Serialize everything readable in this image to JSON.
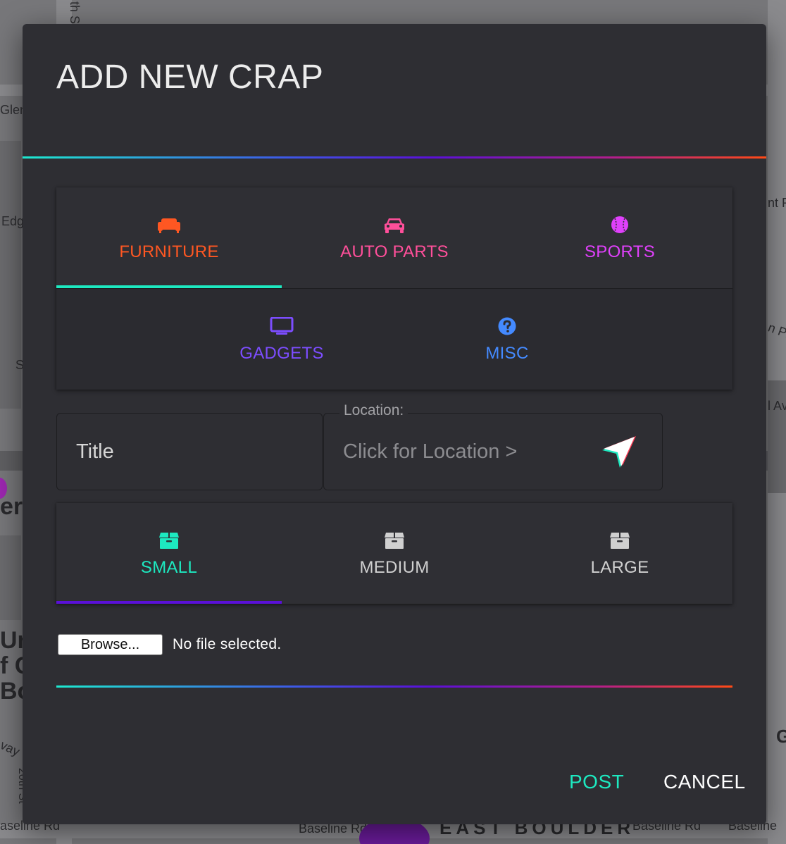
{
  "colors": {
    "accent_teal": "#1de9c0",
    "furniture": "#ff5722",
    "auto_parts": "#ff4f9a",
    "sports": "#e040fb",
    "gadgets": "#7c4dff",
    "misc": "#448aff",
    "inactive": "#d0d0d0",
    "size_indicator": "#5a10d8"
  },
  "map": {
    "labels": [
      "th St",
      "Glen",
      "Edg",
      "nt R",
      "n Pk",
      "S",
      "l Av",
      "er",
      "Un",
      "f C",
      "Bo",
      "vay",
      "20th St",
      "aseline Rd",
      "Baseline Rd",
      "EAST BOULDER",
      "Baseline Rd",
      "Baseline",
      "G"
    ]
  },
  "dialog": {
    "title": "ADD NEW CRAP"
  },
  "categories": {
    "tabs": [
      {
        "label": "FURNITURE",
        "icon": "couch-icon",
        "active": true
      },
      {
        "label": "AUTO PARTS",
        "icon": "car-icon",
        "active": false
      },
      {
        "label": "SPORTS",
        "icon": "baseball-icon",
        "active": false
      },
      {
        "label": "GADGETS",
        "icon": "tv-icon",
        "active": false
      },
      {
        "label": "MISC",
        "icon": "question-circle-icon",
        "active": false
      }
    ]
  },
  "form": {
    "title_placeholder": "Title",
    "location_legend": "Location:",
    "location_placeholder": "Click for Location >",
    "location_icon": "location-arrow-icon"
  },
  "sizes": {
    "tabs": [
      {
        "label": "SMALL",
        "icon": "box-icon",
        "active": true
      },
      {
        "label": "MEDIUM",
        "icon": "box-icon",
        "active": false
      },
      {
        "label": "LARGE",
        "icon": "box-icon",
        "active": false
      }
    ]
  },
  "file": {
    "browse_label": "Browse...",
    "status": "No file selected."
  },
  "actions": {
    "post_label": "POST",
    "cancel_label": "CANCEL"
  }
}
